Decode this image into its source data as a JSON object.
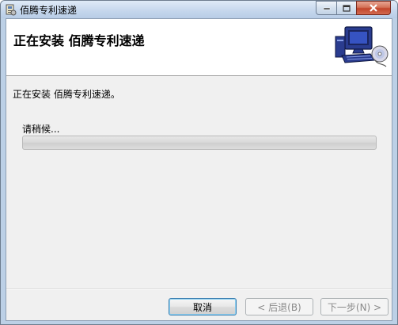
{
  "window": {
    "title": "佰腾专利速递",
    "icon": "installer-app-icon"
  },
  "caption_buttons": {
    "minimize_icon": "minimize-icon",
    "maximize_icon": "maximize-icon",
    "close_icon": "close-icon"
  },
  "banner": {
    "title": "正在安装  佰腾专利速递",
    "graphic": "computer-cd-icon"
  },
  "body": {
    "status_text": "正在安装  佰腾专利速递。",
    "wait_label": "请稍候...",
    "progress_value": 0
  },
  "footer": {
    "cancel_label": "取消",
    "back_label": "< 后退(B)",
    "next_label": "下一步(N) >"
  },
  "colors": {
    "accent_border": "#3c7fb1",
    "close_button": "#c2452b",
    "progress_fill": "#37b837"
  }
}
